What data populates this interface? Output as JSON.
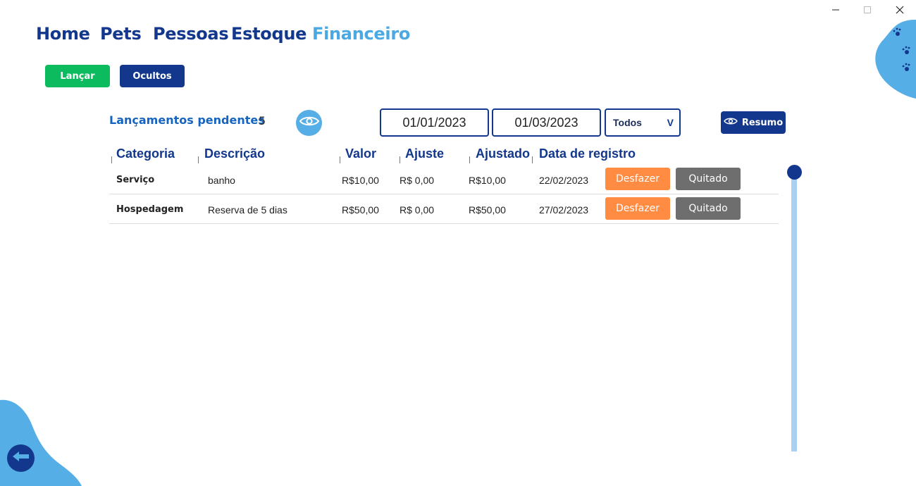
{
  "window": {
    "minimize_icon": "minimize-icon",
    "maximize_icon": "maximize-icon",
    "close_icon": "close-icon"
  },
  "nav": {
    "items": [
      {
        "label": "Home"
      },
      {
        "label": "Pets"
      },
      {
        "label": "Pessoas"
      },
      {
        "label": "Estoque"
      },
      {
        "label": "Financeiro",
        "active": true
      }
    ]
  },
  "toolbar": {
    "lancar_label": "Lançar",
    "ocultos_label": "Ocultos"
  },
  "summary": {
    "title": "Lançamentos pendentes",
    "count": "5"
  },
  "filters": {
    "date_start": "01/01/2023",
    "date_end": "01/03/2023",
    "type_selected": "Todos",
    "type_chevron": "V",
    "resumo_label": "Resumo"
  },
  "table": {
    "headers": {
      "categoria": "Categoria",
      "descricao": "Descrição",
      "valor": "Valor",
      "ajuste": "Ajuste",
      "ajustado": "Ajustado",
      "data": "Data de registro"
    },
    "rows": [
      {
        "categoria": "Serviço",
        "descricao": "banho",
        "valor": "R$10,00",
        "ajuste": "R$ 0,00",
        "ajustado": "R$10,00",
        "data": "22/02/2023",
        "desfazer": "Desfazer",
        "quitado": "Quitado"
      },
      {
        "categoria": "Hospedagem",
        "descricao": "Reserva de 5 dias",
        "valor": "R$50,00",
        "ajuste": "R$ 0,00",
        "ajustado": "R$50,00",
        "data": "27/02/2023",
        "desfazer": "Desfazer",
        "quitado": "Quitado"
      }
    ]
  },
  "colors": {
    "navy": "#12378c",
    "light_blue": "#4aa8e2",
    "green": "#0dbb5f",
    "orange": "#ff8c42",
    "gray": "#6e6e6e"
  }
}
